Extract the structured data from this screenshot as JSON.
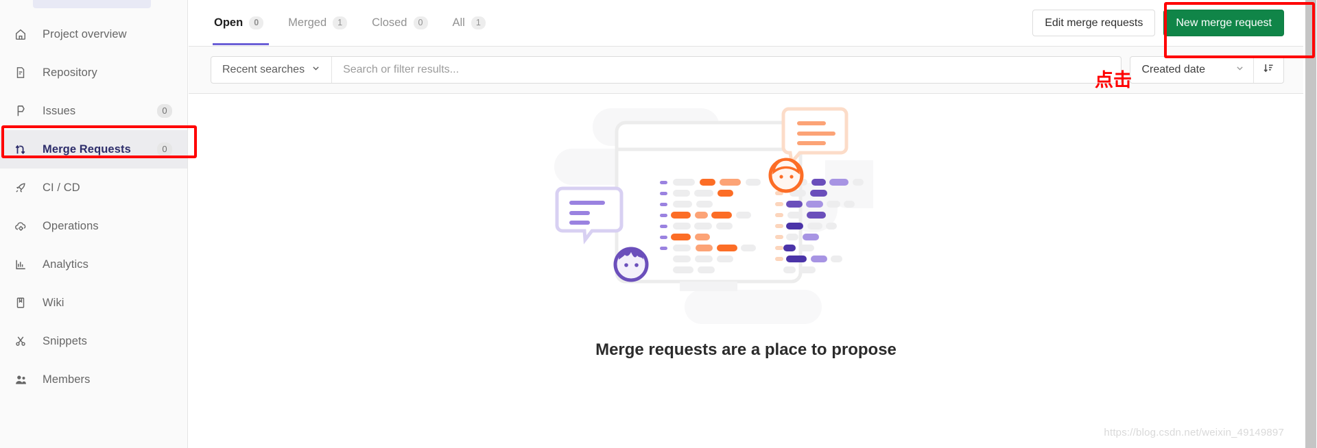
{
  "sidebar": {
    "items": [
      {
        "label": "Project overview",
        "icon": "home-icon",
        "count": "",
        "active": false
      },
      {
        "label": "Repository",
        "icon": "file-icon",
        "count": "",
        "active": false
      },
      {
        "label": "Issues",
        "icon": "issue-icon",
        "count": "0",
        "active": false
      },
      {
        "label": "Merge Requests",
        "icon": "merge-icon",
        "count": "0",
        "active": true
      },
      {
        "label": "CI / CD",
        "icon": "rocket-icon",
        "count": "",
        "active": false
      },
      {
        "label": "Operations",
        "icon": "cloud-gear-icon",
        "count": "",
        "active": false
      },
      {
        "label": "Analytics",
        "icon": "chart-icon",
        "count": "",
        "active": false
      },
      {
        "label": "Wiki",
        "icon": "book-icon",
        "count": "",
        "active": false
      },
      {
        "label": "Snippets",
        "icon": "scissors-icon",
        "count": "",
        "active": false
      },
      {
        "label": "Members",
        "icon": "people-icon",
        "count": "",
        "active": false
      }
    ]
  },
  "tabs": [
    {
      "label": "Open",
      "badge": "0",
      "selected": true
    },
    {
      "label": "Merged",
      "badge": "1",
      "selected": false
    },
    {
      "label": "Closed",
      "badge": "0",
      "selected": false
    },
    {
      "label": "All",
      "badge": "1",
      "selected": false
    }
  ],
  "toolbar": {
    "edit_label": "Edit merge requests",
    "new_label": "New merge request"
  },
  "filter": {
    "recent_searches_label": "Recent searches",
    "search_placeholder": "Search or filter results...",
    "search_value": "",
    "sort_value": "Created date",
    "sort_direction_icon": "sort-descending-icon"
  },
  "empty_state": {
    "title": "Merge requests are a place to propose"
  },
  "annotations": {
    "click_label": "点击"
  },
  "watermark": {
    "text": "https://blog.csdn.net/weixin_49149897"
  },
  "colors": {
    "primary_green": "#108548",
    "accent_purple": "#6b60d6",
    "active_nav_text": "#2e2e6b",
    "annotation_red": "#ff0000",
    "illus_orange": "#fc6d26",
    "illus_purple": "#6b4fbb"
  }
}
